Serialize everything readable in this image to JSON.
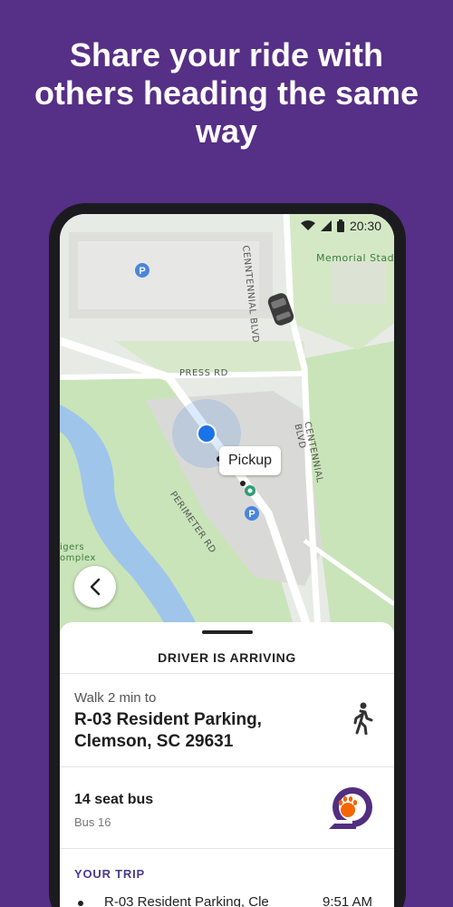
{
  "headline": "Share your ride with\nothers heading the same\nway",
  "status_bar": {
    "time": "20:30"
  },
  "map": {
    "road_labels": [
      "CENNTENNIAL BLVD",
      "PRESS RD",
      "PERIMETER RD",
      "CENTENNIAL BLVD"
    ],
    "place_labels": [
      "Memorial Stadiu",
      "igers",
      "omplex"
    ],
    "pickup_label": "Pickup"
  },
  "sheet": {
    "status": "DRIVER IS ARRIVING",
    "walk_label": "Walk 2 min to",
    "destination": "R-03 Resident Parking, Clemson, SC 29631",
    "vehicle_name": "14 seat bus",
    "vehicle_route": "Bus 16",
    "trip_heading": "YOUR TRIP",
    "trip_stop": "R-03 Resident Parking, Cle",
    "trip_time": "9:51 AM"
  },
  "colors": {
    "background": "#562f86",
    "user_location": "#1a73e8",
    "pickup_marker": "#2e9e74",
    "logo_orange": "#f56600",
    "logo_purple": "#522d80"
  },
  "icons": [
    "wifi-icon",
    "signal-icon",
    "battery-icon",
    "vehicle-icon",
    "parking-icon",
    "chevron-left-icon",
    "walking-person-icon",
    "clemson-tiger-paw-logo"
  ]
}
